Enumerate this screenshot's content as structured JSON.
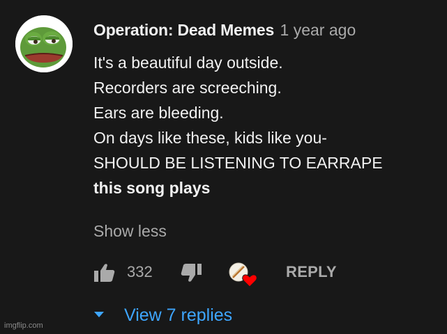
{
  "comment": {
    "author": "Operation: Dead Memes",
    "timestamp": "1 year ago",
    "avatar_icon": "pepe-frog-icon",
    "lines": [
      "It's a beautiful day outside.",
      "Recorders are screeching.",
      "Ears are bleeding.",
      "On days like these, kids like you-",
      "SHOULD BE LISTENING TO EARRAPE",
      "this song plays"
    ],
    "show_less_label": "Show less"
  },
  "actions": {
    "like_icon": "thumbs-up-icon",
    "like_count": "332",
    "dislike_icon": "thumbs-down-icon",
    "hearted_icon": "creator-heart-icon",
    "reply_label": "REPLY"
  },
  "replies": {
    "icon": "caret-down-icon",
    "label": "View 7 replies"
  },
  "watermark": "imgflip.com",
  "colors": {
    "background": "#181818",
    "text_primary": "#f1f1f1",
    "text_secondary": "#aaaaaa",
    "link_blue": "#3ea6ff",
    "heart_red": "#ff0000"
  }
}
